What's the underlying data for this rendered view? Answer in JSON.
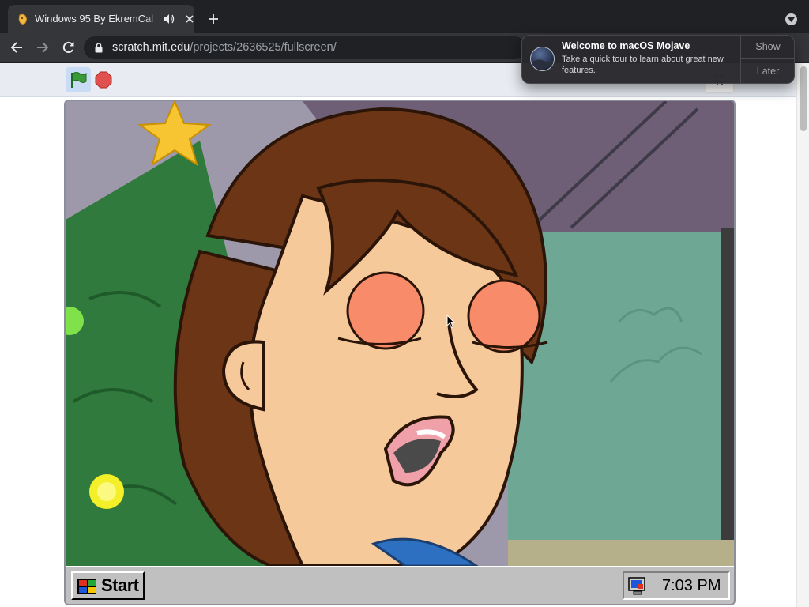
{
  "browser": {
    "tab": {
      "title": "Windows 95 By EkremCal"
    },
    "url": {
      "host": "scratch.mit.edu",
      "path": "/projects/2636525/fullscreen/"
    }
  },
  "notification": {
    "title": "Welcome to macOS Mojave",
    "body": "Take a quick tour to learn about great new features.",
    "show_label": "Show",
    "later_label": "Later"
  },
  "taskbar": {
    "start_label": "Start",
    "clock": "7:03 PM"
  },
  "colors": {
    "browser_chrome": "#202124",
    "toolbar": "#35363a",
    "green_flag": "#3a9a3a",
    "stop": "#e0504f",
    "taskbar": "#c0c0c0"
  },
  "icons": [
    "scratch-favicon",
    "audio-icon",
    "close-icon",
    "plus-icon",
    "chevron-down-icon",
    "back-arrow-icon",
    "forward-arrow-icon",
    "reload-icon",
    "lock-icon",
    "green-flag-icon",
    "stop-icon",
    "fullscreen-icon",
    "windows-logo-icon",
    "tray-monitor-icon",
    "macos-mojave-icon",
    "mouse-cursor-icon"
  ]
}
